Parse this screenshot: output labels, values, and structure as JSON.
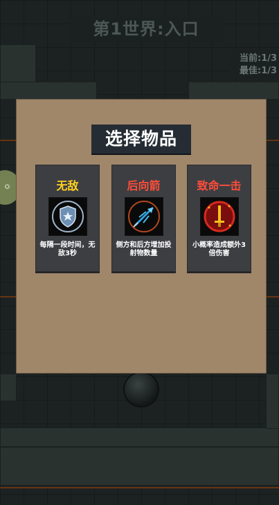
{
  "hud": {
    "world_title": "第1世界:入口",
    "current_label": "当前:1/3",
    "best_label": "最佳:1/3"
  },
  "dialog": {
    "title": "选择物品",
    "cards": [
      {
        "title": "无敌",
        "title_color": "#ffd21f",
        "icon": "shield-icon",
        "desc": "每隔一段时间，无敌3秒"
      },
      {
        "title": "后向箭",
        "title_color": "#ff4d3a",
        "icon": "back-arrow-icon",
        "desc": "侧方和后方增加投射物数量"
      },
      {
        "title": "致命一击",
        "title_color": "#ff4d3a",
        "icon": "sword-crit-icon",
        "desc": "小概率造成额外3倍伤害"
      }
    ]
  },
  "controls": {
    "left_button_icon": "gamepad-icon",
    "joystick_icon": "joystick-icon"
  }
}
